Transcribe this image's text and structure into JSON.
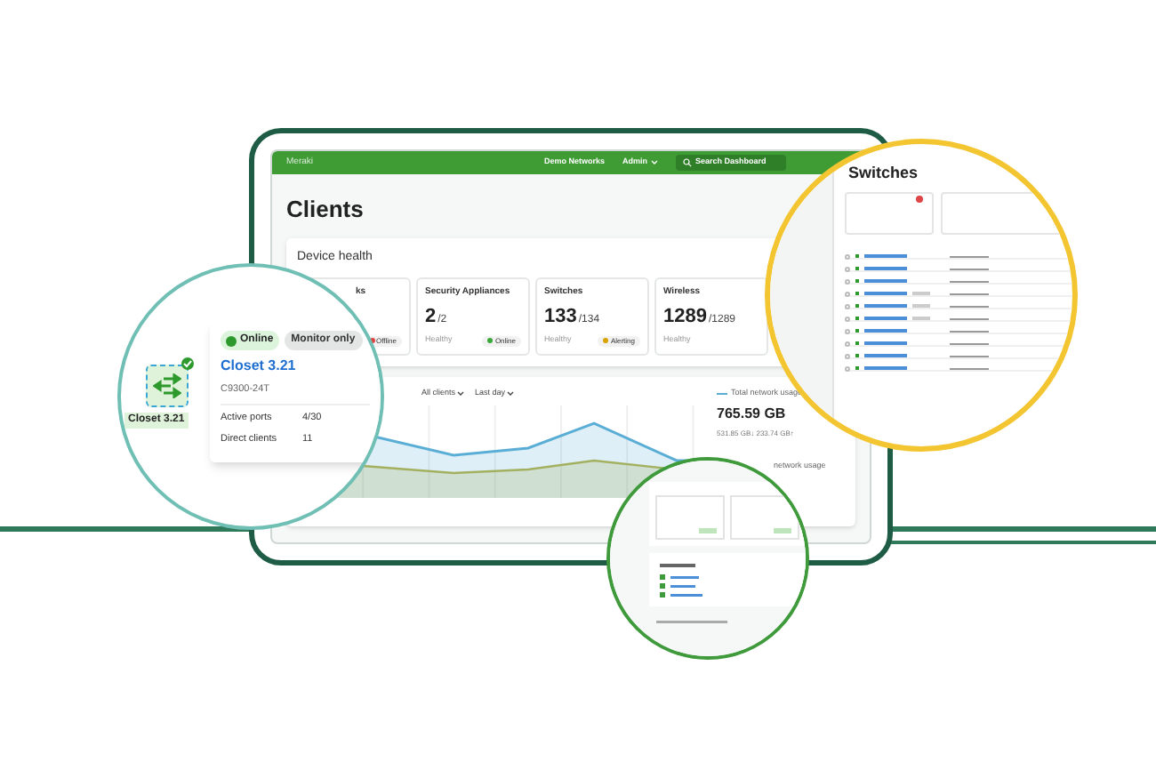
{
  "header": {
    "brand": "Meraki",
    "network": "Demo Networks",
    "user": "Admin",
    "search": {
      "placeholder": "Search Dashboard"
    }
  },
  "page_title": "Clients",
  "device_health": {
    "title": "Device health",
    "cards": [
      {
        "title": "ks",
        "status": "Offline",
        "color": "#e04545"
      },
      {
        "title": "Security Appliances",
        "count": "2",
        "total": "/2",
        "caption": "Healthy",
        "status": "Online",
        "color": "#38a838"
      },
      {
        "title": "Switches",
        "count": "133",
        "total": "/134",
        "caption": "Healthy",
        "status": "Alerting",
        "color": "#d9a400"
      },
      {
        "title": "Wireless",
        "count": "1289",
        "total": "/1289",
        "caption": "Healthy"
      }
    ]
  },
  "usage": {
    "filters": [
      "All clients",
      "Last day"
    ],
    "legend": [
      {
        "label": "Total network usage",
        "color": "#5aaed6",
        "value": "765.59 GB",
        "detail": "531.85 GB↓ 233.74 GB↑"
      },
      {
        "label": "network usage"
      }
    ]
  },
  "device_popup": {
    "icon_label": "Closet 3.21",
    "status": "Online",
    "mode": "Monitor only",
    "name": "Closet 3.21",
    "model": "C9300-24T",
    "stats": [
      {
        "label": "Active ports",
        "value": "4/30"
      },
      {
        "label": "Direct clients",
        "value": "11"
      }
    ]
  },
  "switches_panel": {
    "title": "Switches",
    "rows": [
      {
        "tag": false
      },
      {
        "tag": false
      },
      {
        "tag": false
      },
      {
        "tag": true
      },
      {
        "tag": true
      },
      {
        "tag": true
      },
      {
        "tag": false
      },
      {
        "tag": false
      },
      {
        "tag": false
      },
      {
        "tag": false
      }
    ]
  }
}
